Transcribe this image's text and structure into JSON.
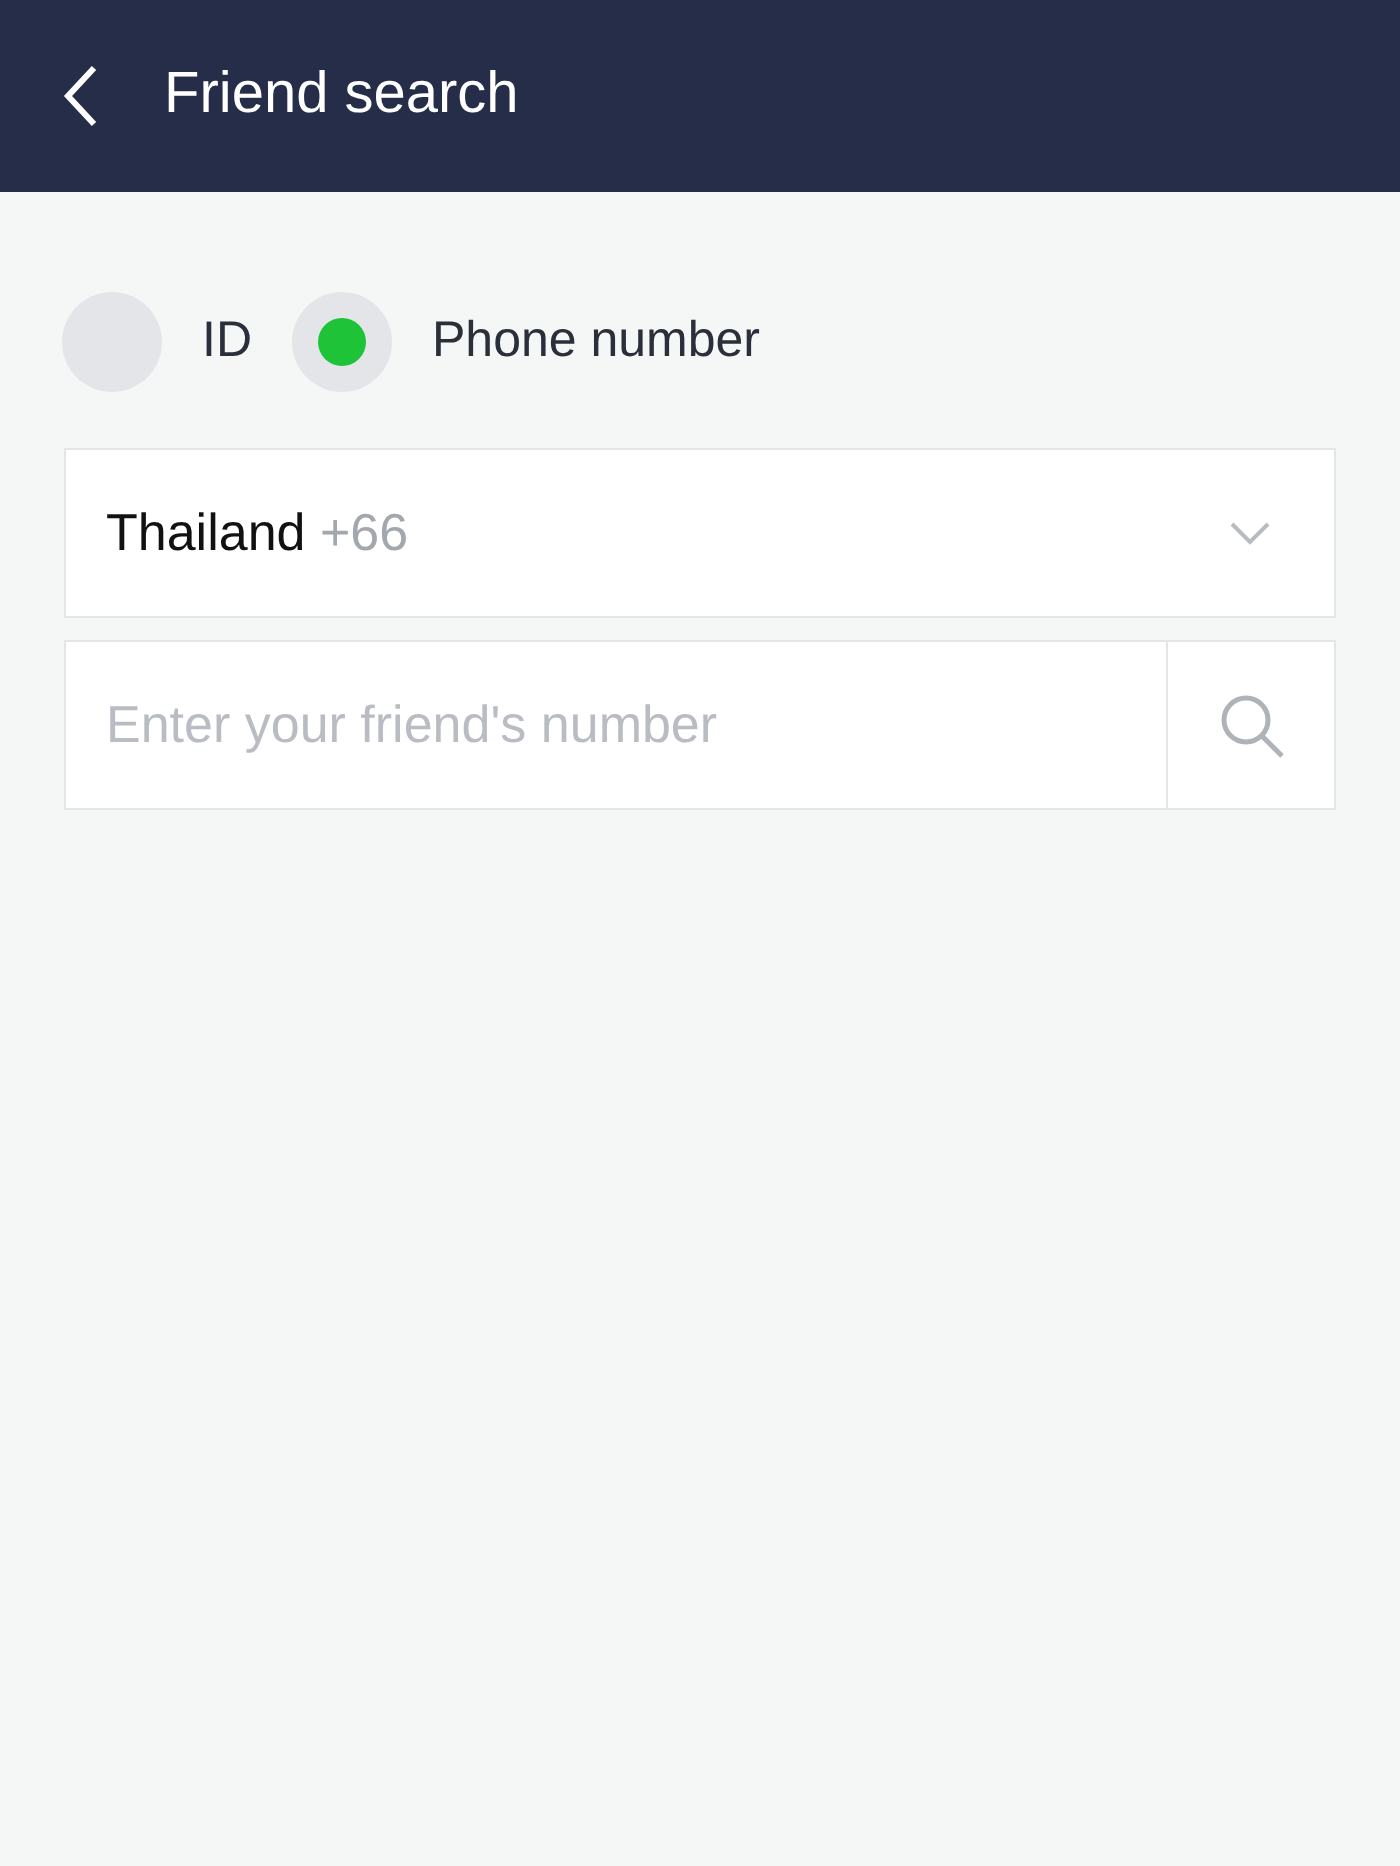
{
  "header": {
    "title": "Friend search"
  },
  "search_by": [
    {
      "label": "ID",
      "selected": false
    },
    {
      "label": "Phone number",
      "selected": true
    }
  ],
  "country": {
    "name": "Thailand",
    "code": "+66"
  },
  "number_field": {
    "placeholder": "Enter your friend's number"
  }
}
